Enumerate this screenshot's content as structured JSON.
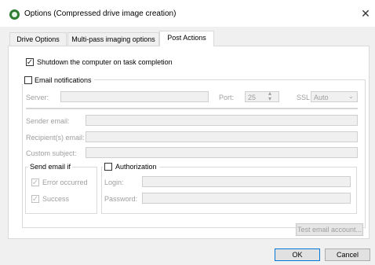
{
  "window": {
    "title": "Options (Compressed drive image creation)"
  },
  "tabs": [
    {
      "label": "Drive Options"
    },
    {
      "label": "Multi-pass imaging options"
    },
    {
      "label": "Post Actions"
    }
  ],
  "post_actions": {
    "shutdown_label": "Shutdown the computer on task completion",
    "shutdown_checked": true,
    "email_notifications_label": "Email notifications",
    "email_notifications_checked": false,
    "server_label": "Server:",
    "server_value": "",
    "port_label": "Port:",
    "port_value": "25",
    "ssl_label": "SSL",
    "ssl_value": "Auto",
    "sender_label": "Sender email:",
    "recipient_label": "Recipient(s) email:",
    "subject_label": "Custom subject:",
    "send_if_title": "Send email if",
    "error_label": "Error occurred",
    "success_label": "Success",
    "auth_label": "Authorization",
    "login_label": "Login:",
    "password_label": "Password:",
    "test_button": "Test email account..."
  },
  "footer": {
    "ok": "OK",
    "cancel": "Cancel"
  }
}
